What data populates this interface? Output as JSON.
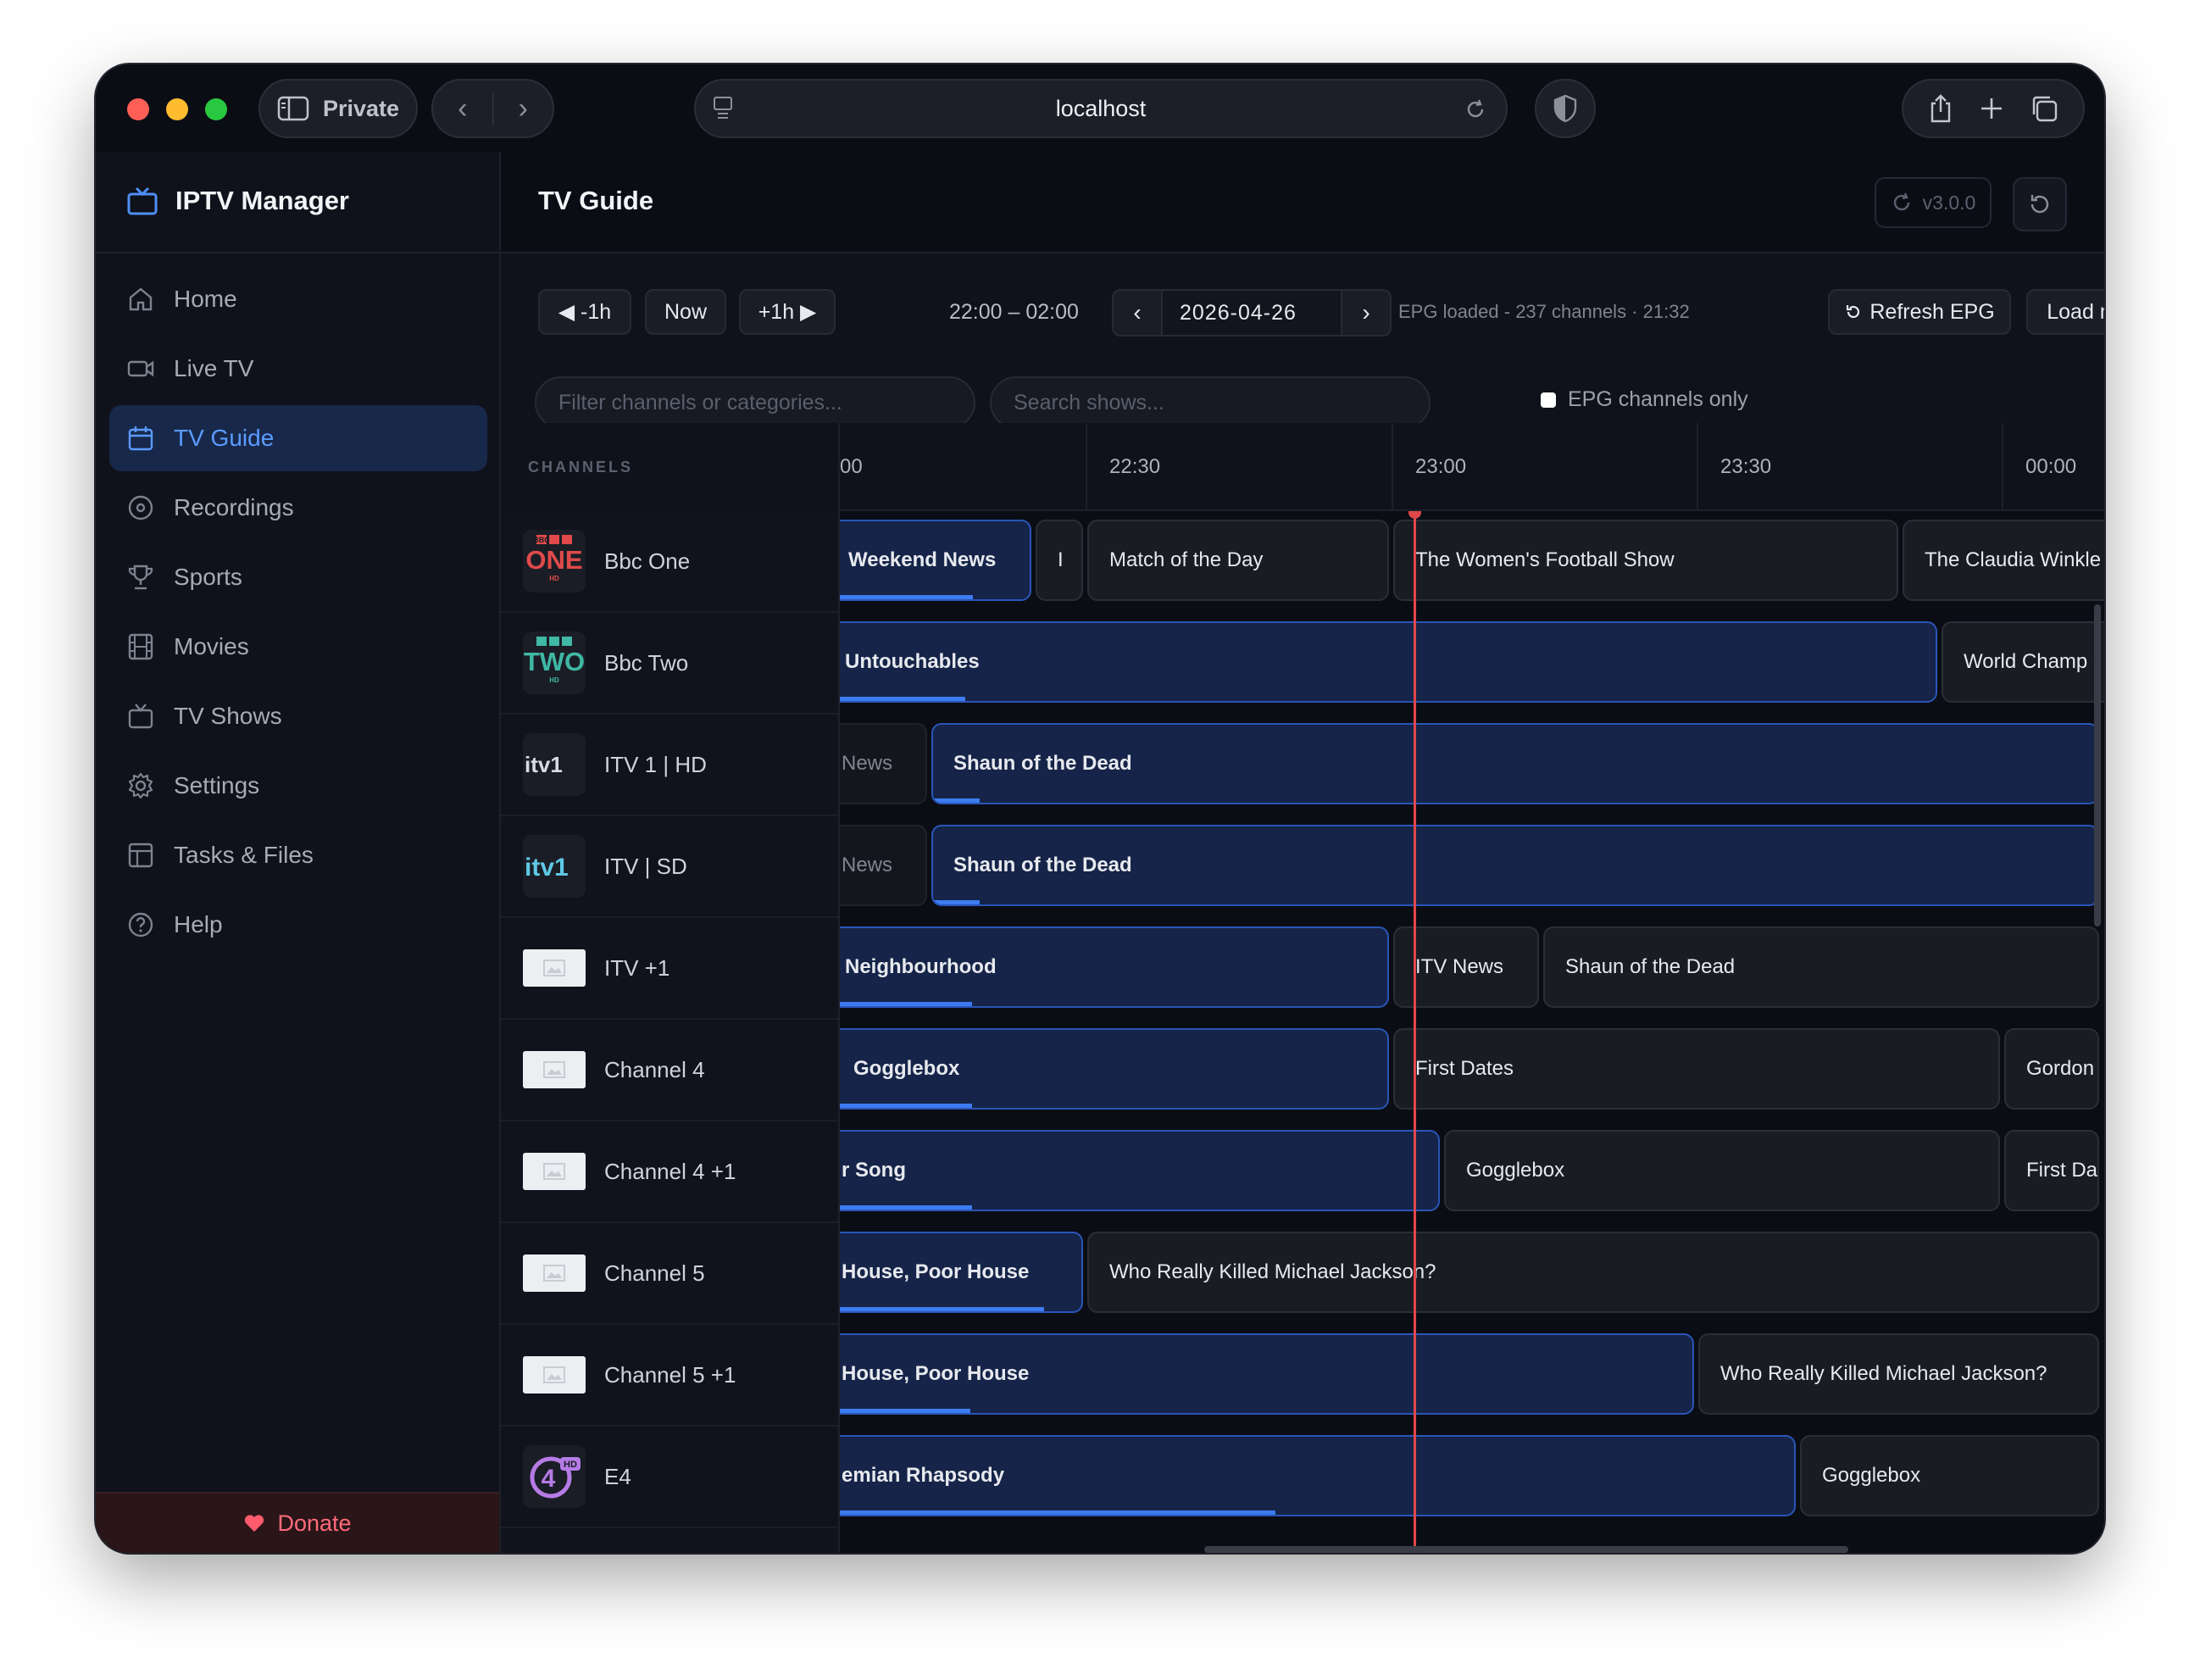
{
  "browser": {
    "private_label": "Private",
    "url": "localhost"
  },
  "sidebar": {
    "brand": "IPTV Manager",
    "items": [
      {
        "label": "Home"
      },
      {
        "label": "Live TV"
      },
      {
        "label": "TV Guide"
      },
      {
        "label": "Recordings"
      },
      {
        "label": "Sports"
      },
      {
        "label": "Movies"
      },
      {
        "label": "TV Shows"
      },
      {
        "label": "Settings"
      },
      {
        "label": "Tasks & Files"
      },
      {
        "label": "Help"
      }
    ],
    "donate": "Donate"
  },
  "header": {
    "title": "TV Guide",
    "version": "v3.0.0"
  },
  "toolbar": {
    "back_label": "◀ -1h",
    "now_label": "Now",
    "fwd_label": "+1h ▶",
    "range": "22:00 – 02:00",
    "date": "2026-04-26",
    "prev": "‹",
    "next": "›",
    "status": "EPG loaded - 237 channels · 21:32",
    "refresh_label": "Refresh EPG",
    "load_more_label": "Load more",
    "filter_placeholder": "Filter channels or categories...",
    "search_placeholder": "Search shows...",
    "epg_only_label": "EPG channels only"
  },
  "guide": {
    "channels_header": "CHANNELS",
    "times": [
      "00",
      "22:30",
      "23:00",
      "23:30",
      "00:00"
    ],
    "channels": [
      {
        "name": "Bbc One"
      },
      {
        "name": "Bbc Two"
      },
      {
        "name": "ITV 1 | HD"
      },
      {
        "name": "ITV | SD"
      },
      {
        "name": "ITV +1"
      },
      {
        "name": "Channel 4"
      },
      {
        "name": "Channel 4 +1"
      },
      {
        "name": "Channel 5"
      },
      {
        "name": "Channel 5 +1"
      },
      {
        "name": "E4"
      }
    ],
    "logos": {
      "bbc": "BBC",
      "one": "ONE",
      "two": "TWO",
      "hd": "HD",
      "itv": "itv1",
      "e4": "4"
    },
    "programmes": [
      [
        {
          "title": "Weekend News",
          "state": "live",
          "progress": 0.71
        },
        {
          "title": "I",
          "state": "normal"
        },
        {
          "title": "Match of the Day",
          "state": "normal"
        },
        {
          "title": "The Women's Football Show",
          "state": "normal"
        },
        {
          "title": "The Claudia Winkle",
          "state": "normal"
        }
      ],
      [
        {
          "title": "Untouchables",
          "state": "live",
          "progress": 0.12
        },
        {
          "title": "World Champ",
          "state": "normal"
        }
      ],
      [
        {
          "title": "News",
          "state": "past"
        },
        {
          "title": "Shaun of the Dead",
          "state": "live",
          "progress": 0.04
        }
      ],
      [
        {
          "title": "News",
          "state": "past"
        },
        {
          "title": "Shaun of the Dead",
          "state": "live",
          "progress": 0.04
        }
      ],
      [
        {
          "title": "Neighbourhood",
          "state": "live",
          "progress": 0.25
        },
        {
          "title": "ITV News",
          "state": "normal"
        },
        {
          "title": "Shaun of the Dead",
          "state": "normal"
        }
      ],
      [
        {
          "title": "Gogglebox",
          "state": "live",
          "progress": 0.25
        },
        {
          "title": "First Dates",
          "state": "normal"
        },
        {
          "title": "Gordon",
          "state": "normal"
        }
      ],
      [
        {
          "title": "r Song",
          "state": "live",
          "progress": 0.23
        },
        {
          "title": "Gogglebox",
          "state": "normal"
        },
        {
          "title": "First Dat",
          "state": "normal"
        }
      ],
      [
        {
          "title": "House, Poor House",
          "state": "live",
          "progress": 0.85
        },
        {
          "title": "Who Really Killed Michael Jackson?",
          "state": "normal"
        }
      ],
      [
        {
          "title": "House, Poor House",
          "state": "live",
          "progress": 0.16
        },
        {
          "title": "Who Really Killed Michael Jackson?",
          "state": "normal"
        }
      ],
      [
        {
          "title": "emian Rhapsody",
          "state": "live",
          "progress": 0.46
        },
        {
          "title": "Gogglebox",
          "state": "normal"
        }
      ]
    ]
  }
}
